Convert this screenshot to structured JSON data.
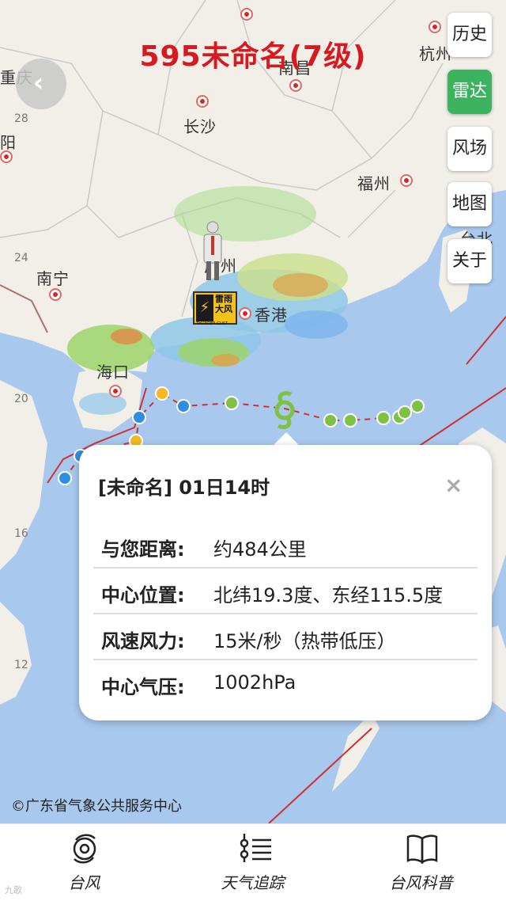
{
  "title": "595未命名(7级)",
  "side_buttons": [
    {
      "label": "历史",
      "active": false
    },
    {
      "label": "雷达",
      "active": true
    },
    {
      "label": "风场",
      "active": false
    },
    {
      "label": "地图",
      "active": false
    },
    {
      "label": "关于",
      "active": false
    }
  ],
  "map": {
    "cities": [
      "重庆",
      "南昌",
      "杭州",
      "长沙",
      "福州",
      "台北",
      "南宁",
      "广州",
      "香港",
      "海口",
      "阳"
    ],
    "latitudes": [
      "28",
      "24",
      "20",
      "16",
      "12"
    ],
    "warning": {
      "line1": "雷雨",
      "line2": "大风",
      "level": "黄",
      "en": "THUNDER GUST"
    },
    "colors": {
      "sea": "#a8c8ee",
      "land": "#f2efe9",
      "track": "#d32f2f",
      "green_point": "#7dc242",
      "blue_point": "#2f8de4",
      "yellow_point": "#f5b820",
      "active": "#3db25f"
    }
  },
  "popup": {
    "header": "[未命名] 01日14时",
    "close_symbol": "×",
    "rows": [
      {
        "key": "与您距离:",
        "value": "约484公里"
      },
      {
        "key": "中心位置:",
        "value": "北纬19.3度、东经115.5度"
      },
      {
        "key": "风速风力:",
        "value": "15米/秒（热带低压）"
      },
      {
        "key": "中心气压:",
        "value": "1002hPa"
      }
    ]
  },
  "copyright": "©广东省气象公共服务中心",
  "nav": [
    {
      "label": "台风",
      "icon": "typhoon-icon"
    },
    {
      "label": "天气追踪",
      "icon": "tracking-icon"
    },
    {
      "label": "台风科普",
      "icon": "book-icon"
    }
  ],
  "watermark": "九歌"
}
